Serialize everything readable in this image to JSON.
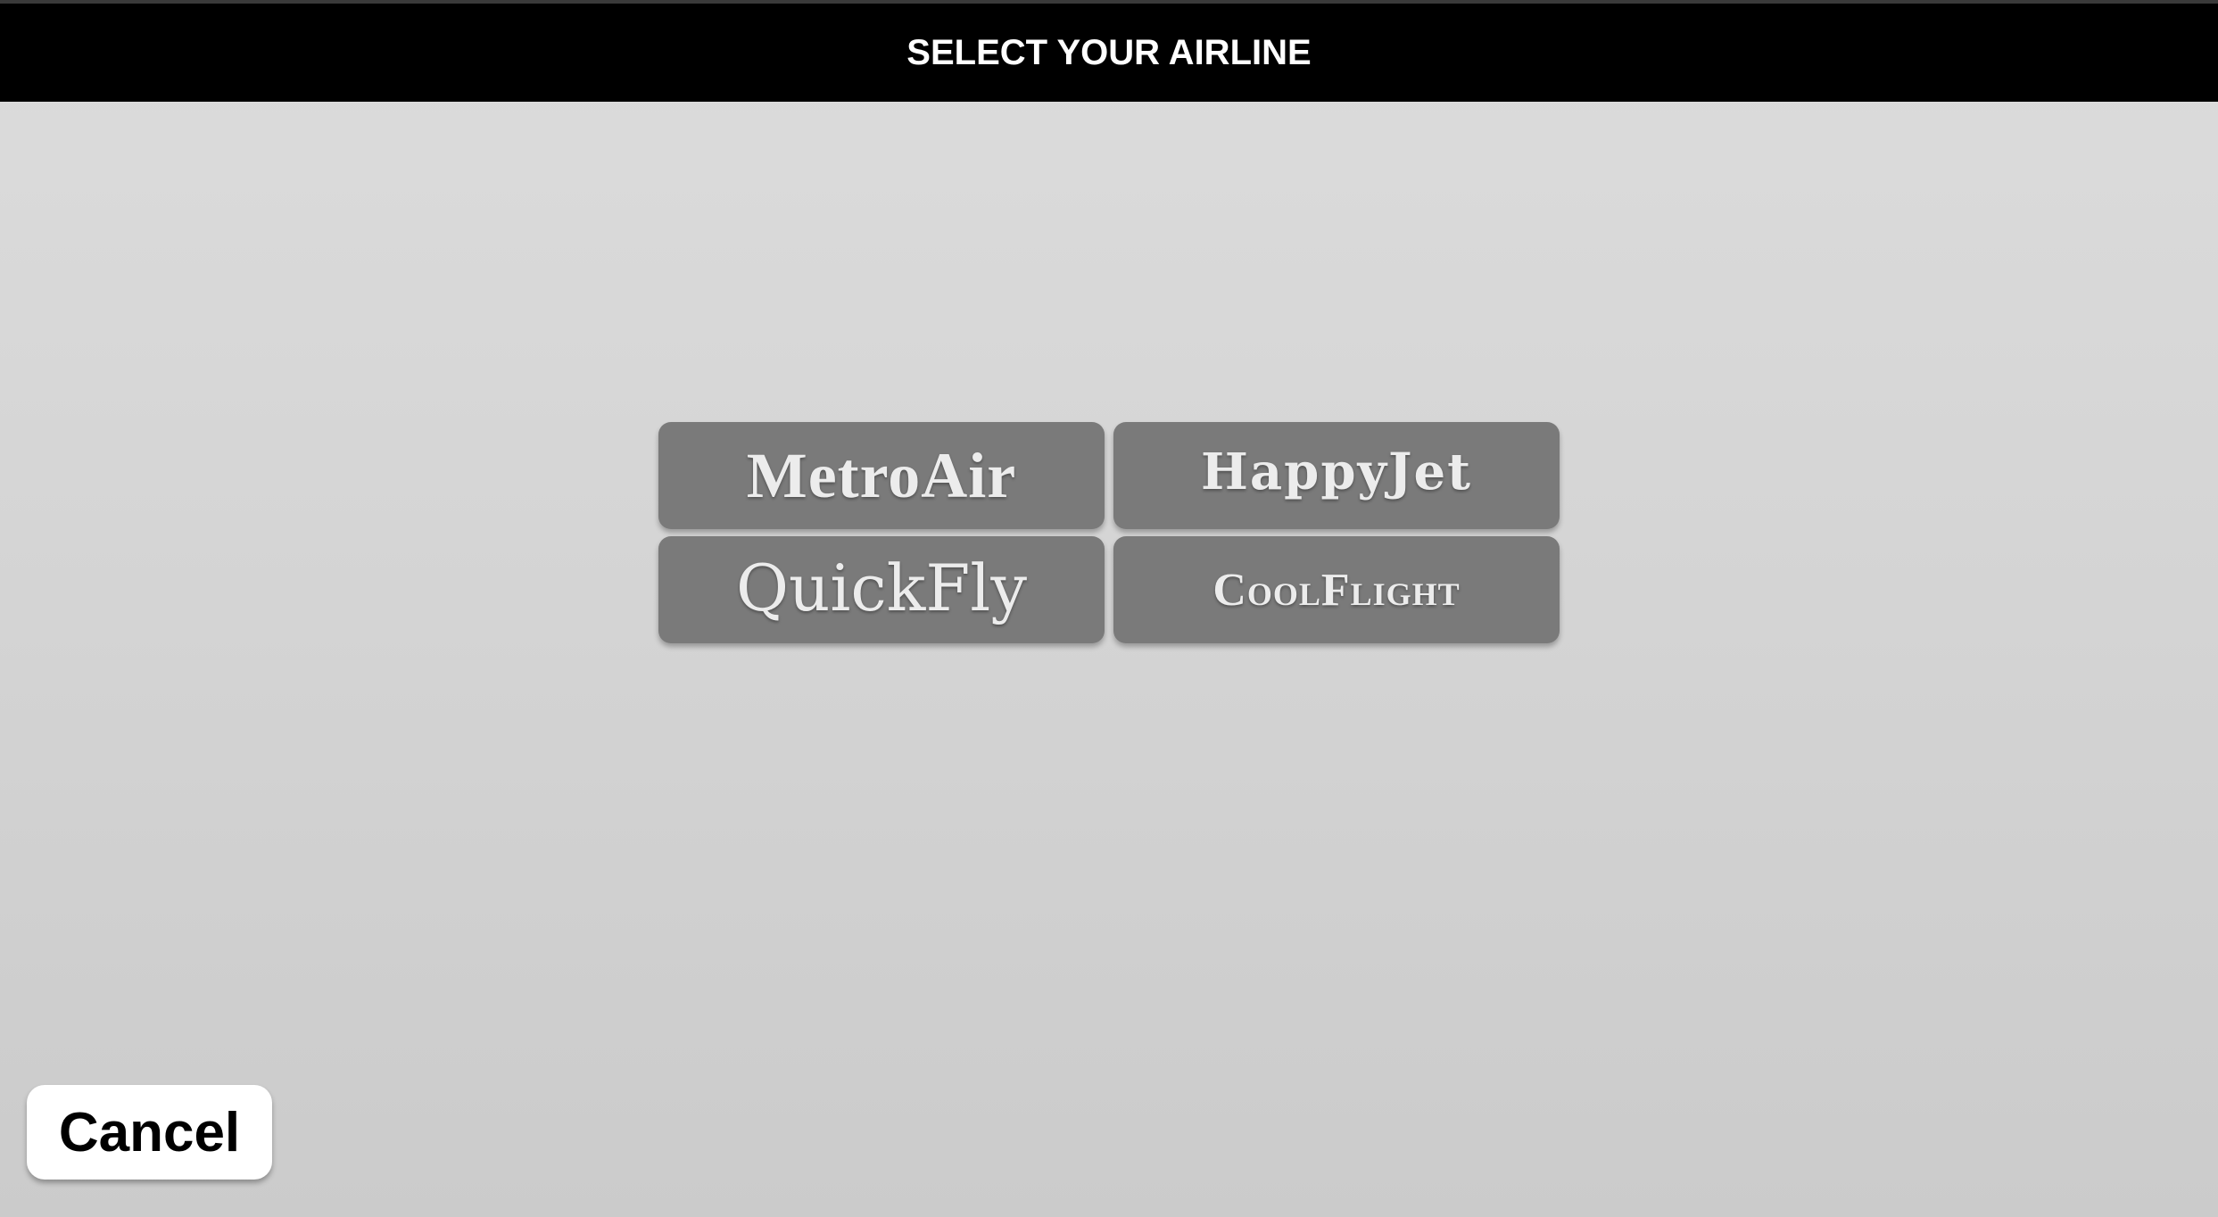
{
  "header": {
    "title": "SELECT YOUR AIRLINE"
  },
  "airlines": [
    {
      "label": "MetroAir"
    },
    {
      "label": "HappyJet"
    },
    {
      "label": "QuickFly"
    },
    {
      "label": "CoolFlight"
    }
  ],
  "footer": {
    "cancel_label": "Cancel"
  },
  "colors": {
    "header_bg": "#000000",
    "header_text": "#ffffff",
    "airline_button_bg": "#7a7a7a",
    "airline_button_text": "#ececec",
    "cancel_button_bg": "#ffffff",
    "page_bg": "#d4d4d4"
  }
}
